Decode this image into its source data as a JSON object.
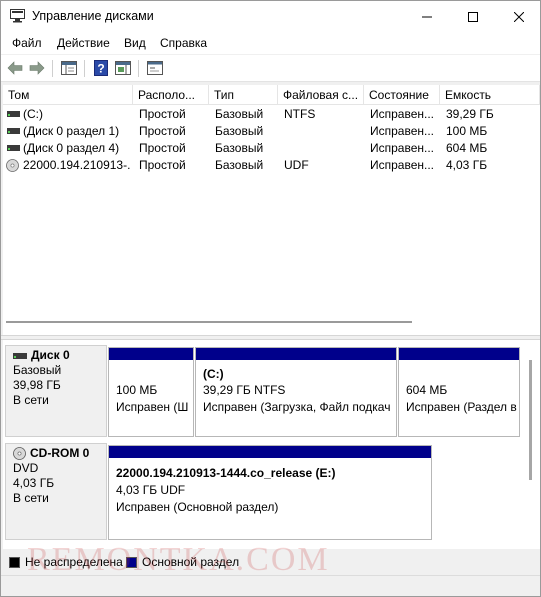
{
  "window": {
    "title": "Управление дисками",
    "controls": [
      "minimize-icon",
      "maximize-icon",
      "close-icon"
    ]
  },
  "menu": [
    "Файл",
    "Действие",
    "Вид",
    "Справка"
  ],
  "toolbar": [
    "back-arrow-icon",
    "forward-arrow-icon",
    "console-tree-icon",
    "help-icon",
    "action-pane-icon",
    "properties-icon"
  ],
  "volume_list": {
    "columns": [
      "Том",
      "Располо...",
      "Тип",
      "Файловая с...",
      "Состояние",
      "Емкость"
    ],
    "rows": [
      {
        "icon": "volume-icon",
        "name": "(C:)",
        "layout": "Простой",
        "type": "Базовый",
        "fs": "NTFS",
        "status": "Исправен...",
        "capacity": "39,29 ГБ"
      },
      {
        "icon": "volume-icon",
        "name": "(Диск 0 раздел 1)",
        "layout": "Простой",
        "type": "Базовый",
        "fs": "",
        "status": "Исправен...",
        "capacity": "100 МБ"
      },
      {
        "icon": "volume-icon",
        "name": "(Диск 0 раздел 4)",
        "layout": "Простой",
        "type": "Базовый",
        "fs": "",
        "status": "Исправен...",
        "capacity": "604 МБ"
      },
      {
        "icon": "cd-icon",
        "name": "22000.194.210913-...",
        "layout": "Простой",
        "type": "Базовый",
        "fs": "UDF",
        "status": "Исправен...",
        "capacity": "4,03 ГБ"
      }
    ]
  },
  "disks": [
    {
      "icon": "hard-disk-icon",
      "name": "Диск 0",
      "kind": "Базовый",
      "size": "39,98 ГБ",
      "state": "В сети",
      "partitions": [
        {
          "title": "",
          "line1": "100 МБ",
          "line2": "Исправен (Ш"
        },
        {
          "title": "(C:)",
          "line1": "39,29 ГБ NTFS",
          "line2": "Исправен (Загрузка, Файл подкач"
        },
        {
          "title": "",
          "line1": "604 МБ",
          "line2": "Исправен (Раздел в"
        }
      ]
    },
    {
      "icon": "cd-rom-icon",
      "name": "CD-ROM 0",
      "kind": "DVD",
      "size": "4,03 ГБ",
      "state": "В сети",
      "partitions": [
        {
          "title": "22000.194.210913-1444.co_release  (E:)",
          "line1": "4,03 ГБ UDF",
          "line2": "Исправен (Основной раздел)"
        }
      ]
    }
  ],
  "legend": [
    {
      "label": "Не распределена",
      "color": "#000000"
    },
    {
      "label": "Основной раздел",
      "color": "#00008b"
    }
  ],
  "colors": {
    "primary_partition": "#00008b",
    "unallocated": "#000000"
  },
  "watermark": "REMONTKA.COM"
}
